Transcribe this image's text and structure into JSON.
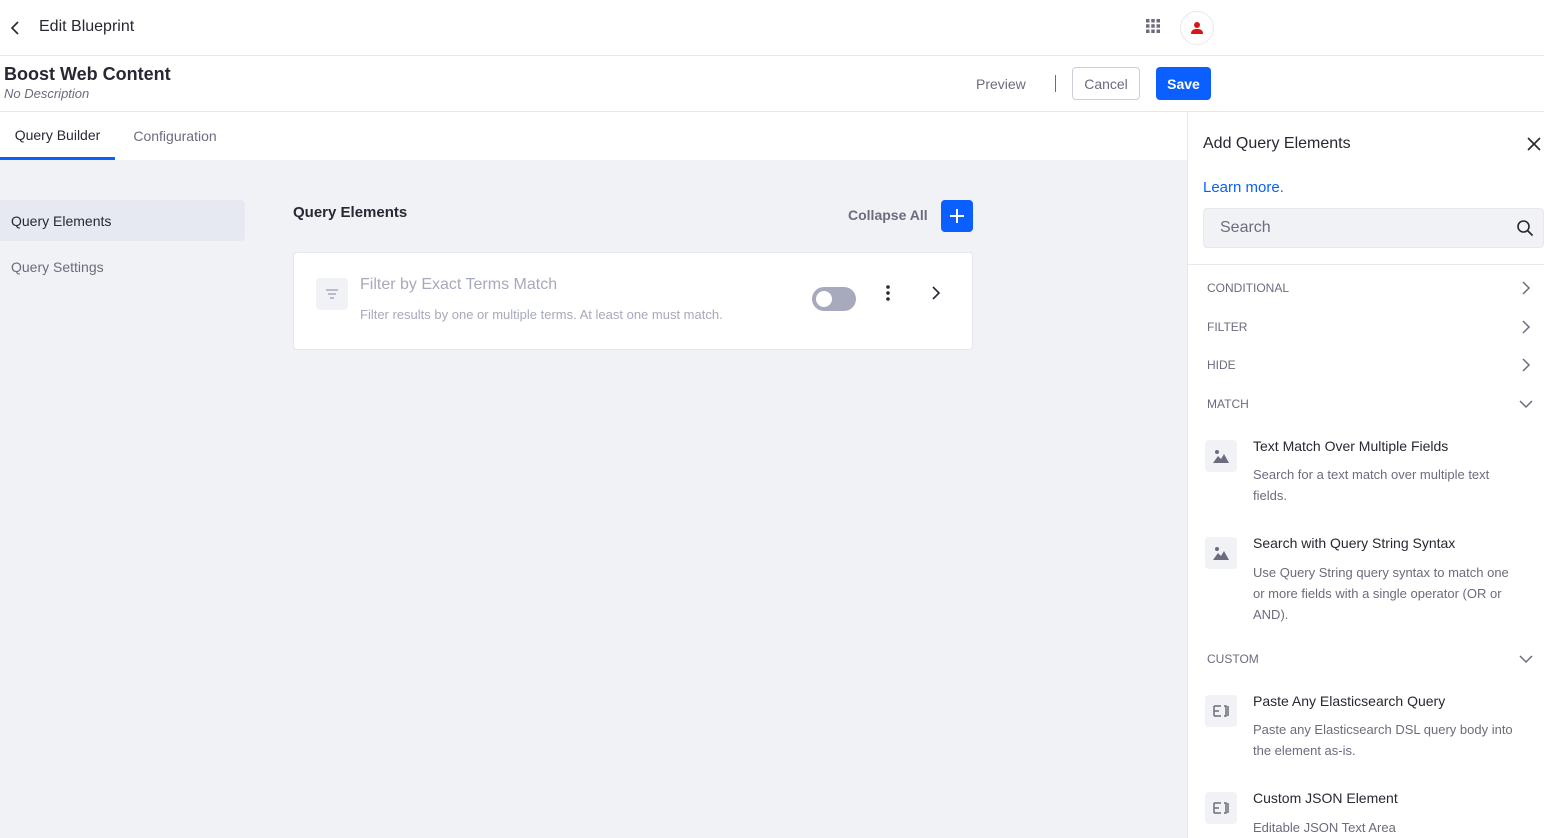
{
  "topbar": {
    "title": "Edit Blueprint"
  },
  "header": {
    "title": "Boost Web Content",
    "description": "No Description",
    "preview_label": "Preview",
    "cancel_label": "Cancel",
    "save_label": "Save"
  },
  "tabs": [
    {
      "label": "Query Builder",
      "active": true
    },
    {
      "label": "Configuration",
      "active": false
    }
  ],
  "nav": [
    {
      "label": "Query Elements",
      "active": true
    },
    {
      "label": "Query Settings",
      "active": false
    }
  ],
  "main": {
    "section_title": "Query Elements",
    "collapse_all_label": "Collapse All",
    "elements": [
      {
        "title": "Filter by Exact Terms Match",
        "description": "Filter results by one or multiple terms. At least one must match.",
        "enabled": false
      }
    ]
  },
  "sidebar": {
    "title": "Add Query Elements",
    "learn_more": "Learn more.",
    "search_placeholder": "Search",
    "categories": [
      {
        "label": "CONDITIONAL",
        "expanded": false
      },
      {
        "label": "FILTER",
        "expanded": false
      },
      {
        "label": "HIDE",
        "expanded": false
      },
      {
        "label": "MATCH",
        "expanded": true
      },
      {
        "label": "CUSTOM",
        "expanded": true
      }
    ],
    "match_items": [
      {
        "title": "Text Match Over Multiple Fields",
        "description": "Search for a text match over multiple text fields.",
        "icon": "image-icon"
      },
      {
        "title": "Search with Query String Syntax",
        "description": "Use Query String query syntax to match one or more fields with a single operator (OR or AND).",
        "icon": "image-icon"
      }
    ],
    "custom_items": [
      {
        "title": "Paste Any Elasticsearch Query",
        "description": "Paste any Elasticsearch DSL query body into the element as-is.",
        "icon": "code-icon"
      },
      {
        "title": "Custom JSON Element",
        "description": "Editable JSON Text Area",
        "icon": "code-icon"
      }
    ]
  },
  "colors": {
    "primary": "#0b5fff",
    "avatar_icon": "#da1414",
    "muted_text": "#6b6c7e",
    "disabled_text": "#a7a9bc",
    "background_gray": "#f1f2f5"
  }
}
